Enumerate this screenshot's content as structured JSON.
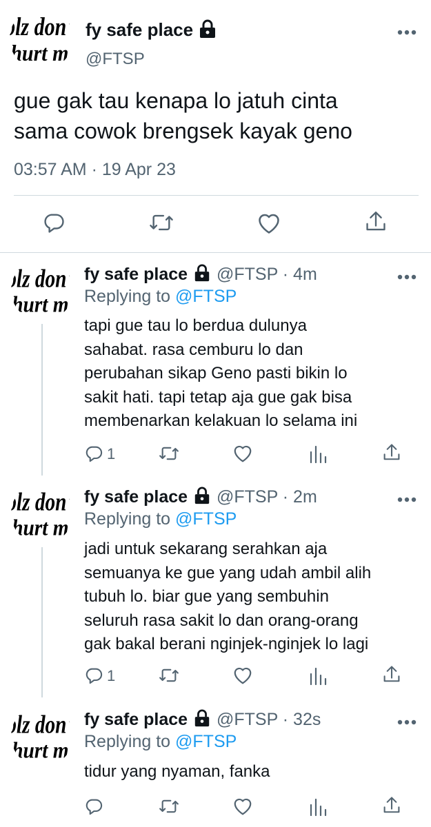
{
  "main_tweet": {
    "avatar_text": "plz don't hurt me",
    "display_name": "fy safe place",
    "handle": "@FTSP",
    "text_line1": "gue gak tau kenapa lo jatuh cinta",
    "text_line2": "sama cowok brengsek kayak geno",
    "timestamp": "03:57 AM · 19 Apr 23",
    "actions": [
      "reply-icon",
      "retweet-icon",
      "like-icon",
      "share-icon"
    ]
  },
  "replies": [
    {
      "avatar_text": "plz don't hurt me",
      "display_name": "fy safe place",
      "handle": "@FTSP",
      "time": "· 4m",
      "replying_prefix": "Replying to",
      "replying_to": "@FTSP",
      "lines": [
        "tapi gue tau lo berdua dulunya",
        "sahabat. rasa cemburu lo dan",
        "perubahan sikap Geno pasti bikin lo",
        "sakit hati. tapi tetap aja gue gak bisa",
        "membenarkan kelakuan lo selama ini"
      ],
      "reply_count": "1"
    },
    {
      "avatar_text": "plz don't hurt me",
      "display_name": "fy safe place",
      "handle": "@FTSP",
      "time": "· 2m",
      "replying_prefix": "Replying to",
      "replying_to": "@FTSP",
      "lines": [
        "jadi untuk sekarang serahkan aja",
        "semuanya ke gue yang udah ambil alih",
        "tubuh lo. biar gue yang sembuhin",
        "seluruh rasa sakit lo dan orang-orang",
        "gak bakal berani nginjek-nginjek lo lagi"
      ],
      "reply_count": "1"
    },
    {
      "avatar_text": "plz don't hurt me",
      "display_name": "fy safe place",
      "handle": "@FTSP",
      "time": "· 32s",
      "replying_prefix": "Replying to",
      "replying_to": "@FTSP",
      "lines": [
        "tidur yang nyaman, fanka"
      ],
      "reply_count": ""
    }
  ],
  "colors": {
    "text": "#0f1419",
    "muted": "#536471",
    "link": "#1d9bf0",
    "divider": "#cfd9de"
  }
}
